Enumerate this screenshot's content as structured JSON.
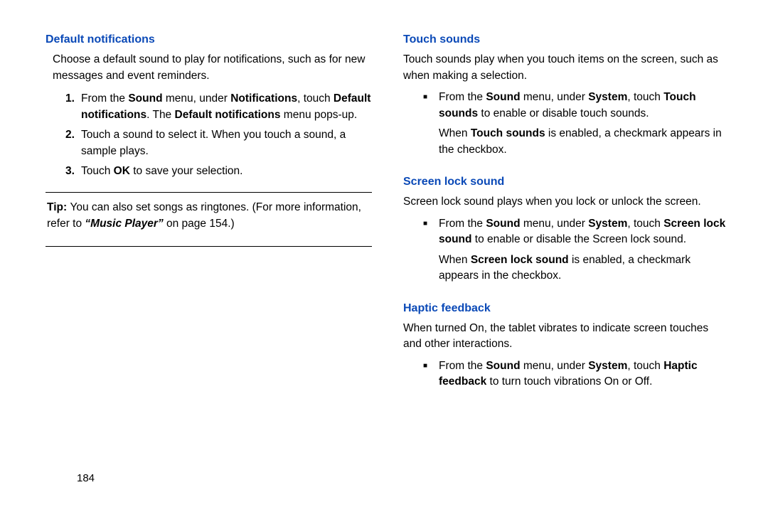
{
  "left": {
    "h1": "Default notifications",
    "intro": "Choose a default sound to play for notifications, such as for new messages and event reminders.",
    "steps": {
      "n1": "1.",
      "s1a": "From the ",
      "s1b": "Sound",
      "s1c": " menu, under ",
      "s1d": "Notifications",
      "s1e": ", touch ",
      "s1f": "Default notifications",
      "s1g": ". The ",
      "s1h": "Default notifications",
      "s1i": " menu pops-up.",
      "n2": "2.",
      "s2": "Touch a sound to select it. When you touch a sound, a sample plays.",
      "n3": "3.",
      "s3a": "Touch ",
      "s3b": "OK",
      "s3c": " to save your selection."
    },
    "tip": {
      "lead": "Tip: ",
      "a": "You can also set songs as ringtones. (For more information, refer to ",
      "ref": "“Music Player”",
      "b": " on page 154.)"
    }
  },
  "right": {
    "touch": {
      "h": "Touch sounds",
      "intro": "Touch sounds play when you touch items on the screen, such as when making a selection.",
      "b1a": "From the ",
      "b1b": "Sound",
      "b1c": " menu, under ",
      "b1d": "System",
      "b1e": ", touch ",
      "b1f": "Touch sounds",
      "b1g": " to enable or disable touch sounds.",
      "b2a": "When ",
      "b2b": "Touch sounds",
      "b2c": " is enabled, a checkmark appears in the checkbox."
    },
    "screen": {
      "h": "Screen lock sound",
      "intro": "Screen lock sound plays when you lock or unlock the screen.",
      "b1a": "From the ",
      "b1b": "Sound",
      "b1c": " menu, under ",
      "b1d": "System",
      "b1e": ", touch ",
      "b1f": "Screen lock sound",
      "b1g": " to enable or disable the Screen lock sound.",
      "b2a": "When ",
      "b2b": "Screen lock sound",
      "b2c": " is enabled, a checkmark appears in the checkbox."
    },
    "haptic": {
      "h": "Haptic feedback",
      "intro": "When turned On, the tablet vibrates to indicate screen touches and other interactions.",
      "b1a": "From the ",
      "b1b": "Sound",
      "b1c": " menu, under ",
      "b1d": "System",
      "b1e": ", touch ",
      "b1f": "Haptic feedback",
      "b1g": " to turn touch vibrations On or Off."
    }
  },
  "pagenum": "184",
  "bullet": "■"
}
